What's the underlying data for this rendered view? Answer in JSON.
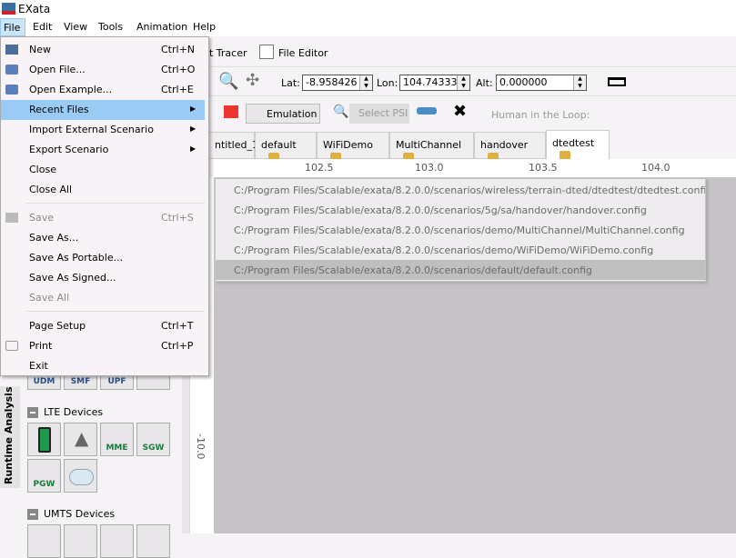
{
  "app": {
    "title": "EXata"
  },
  "menubar": [
    "File",
    "Edit",
    "View",
    "Tools",
    "Animation",
    "Help"
  ],
  "toolbar1": {
    "packet_tracer": "t Tracer",
    "file_editor": "File Editor"
  },
  "toolbar2": {
    "lat_label": "Lat:",
    "lat": "-8.958426",
    "lon_label": "Lon:",
    "lon": "104.743338",
    "alt_label": "Alt:",
    "alt": "0.000000"
  },
  "toolbar3": {
    "mode": "Emulation",
    "select_psi": "Select PSI",
    "hitl_label": "Human in the Loop:"
  },
  "tabs": [
    "ntitled_1",
    "default",
    "WiFiDemo",
    "MultiChannel",
    "handover",
    "dtedtest"
  ],
  "ruler": {
    "h": [
      "102.5",
      "103.0",
      "103.5",
      "104.0"
    ],
    "v": [
      "-10.0"
    ]
  },
  "file_menu": [
    {
      "label": "New",
      "shortcut": "Ctrl+N",
      "icon": "new-file-icon"
    },
    {
      "label": "Open File...",
      "shortcut": "Ctrl+O",
      "icon": "folder-icon"
    },
    {
      "label": "Open Example...",
      "shortcut": "Ctrl+E",
      "icon": "folder-icon"
    },
    {
      "label": "Recent Files",
      "submenu": true,
      "highlighted": true
    },
    {
      "label": "Import External Scenario",
      "submenu": true
    },
    {
      "label": "Export Scenario",
      "submenu": true
    },
    {
      "label": "Close"
    },
    {
      "label": "Close All"
    },
    {
      "label": "Save",
      "shortcut": "Ctrl+S",
      "disabled": true,
      "icon": "save-icon"
    },
    {
      "label": "Save As..."
    },
    {
      "label": "Save As Portable..."
    },
    {
      "label": "Save As Signed..."
    },
    {
      "label": "Save All",
      "disabled": true
    },
    {
      "label": "Page Setup",
      "shortcut": "Ctrl+T"
    },
    {
      "label": "Print",
      "shortcut": "Ctrl+P",
      "icon": "printer-icon"
    },
    {
      "label": "Exit"
    }
  ],
  "recent_files": [
    "C:/Program Files/Scalable/exata/8.2.0.0/scenarios/wireless/terrain-dted/dtedtest/dtedtest.config",
    "C:/Program Files/Scalable/exata/8.2.0.0/scenarios/5g/sa/handover/handover.config",
    "C:/Program Files/Scalable/exata/8.2.0.0/scenarios/demo/MultiChannel/MultiChannel.config",
    "C:/Program Files/Scalable/exata/8.2.0.0/scenarios/demo/WiFiDemo/WiFiDemo.config",
    "C:/Program Files/Scalable/exata/8.2.0.0/scenarios/default/default.config"
  ],
  "palette": {
    "row_5g": [
      "UDM",
      "SMF",
      "UPF",
      ""
    ],
    "lte_title": "LTE Devices",
    "lte": [
      "",
      "",
      "MME",
      "SGW",
      "PGW",
      ""
    ],
    "umts_title": "UMTS Devices",
    "side_tab": "Runtime Analysis"
  },
  "colors": {
    "highlight": "#99cbf5",
    "canvas": "#c5c3c6"
  }
}
